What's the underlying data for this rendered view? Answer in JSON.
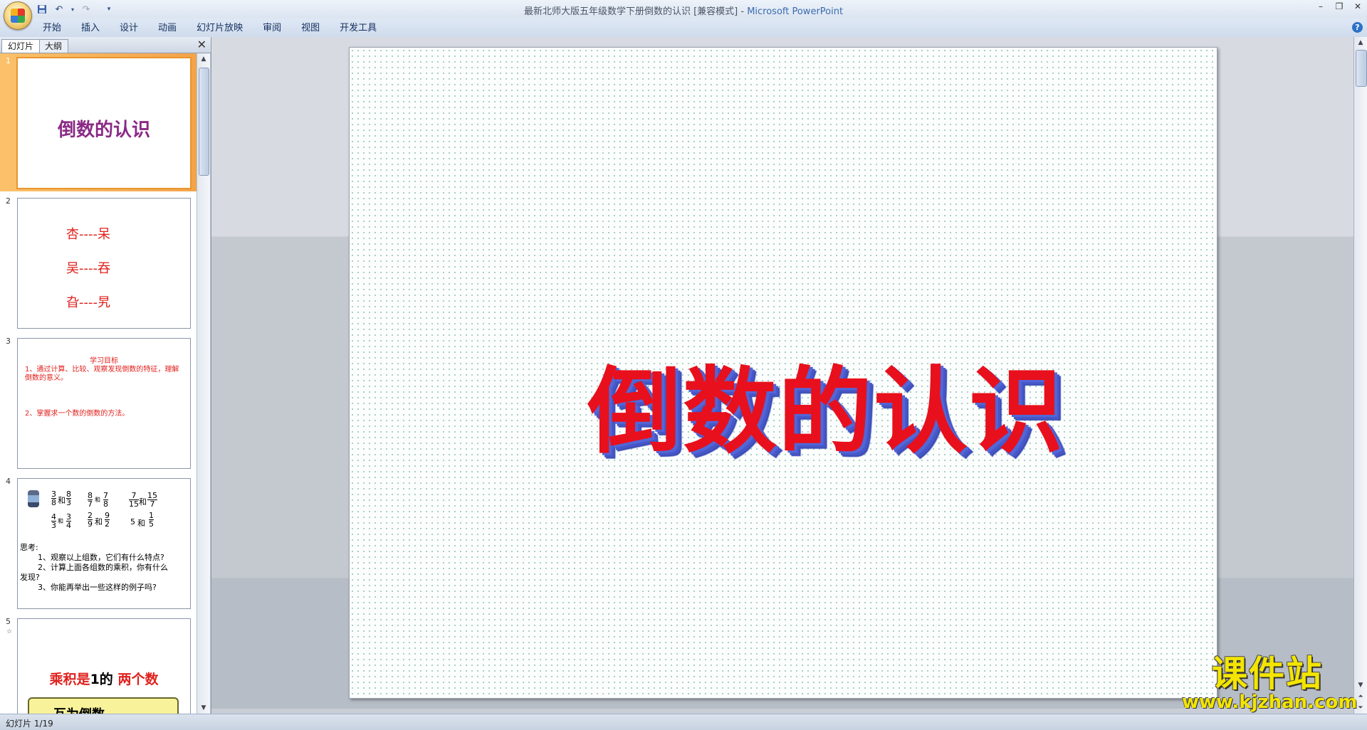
{
  "window": {
    "title": "最新北师大版五年级数学下册倒数的认识 [兼容模式]",
    "app_name": "Microsoft PowerPoint",
    "separator": " - "
  },
  "qat": {
    "save_icon": "save-icon",
    "undo_icon": "undo-icon",
    "redo_icon": "redo-icon",
    "customize_icon": "customize-icon"
  },
  "ribbon": {
    "tabs": [
      "开始",
      "插入",
      "设计",
      "动画",
      "幻灯片放映",
      "审阅",
      "视图",
      "开发工具"
    ]
  },
  "pane": {
    "tabs": [
      "幻灯片",
      "大纲"
    ],
    "close": "✕"
  },
  "thumbnails": {
    "s1": {
      "num": "1",
      "title": "倒数的认识"
    },
    "s2": {
      "num": "2",
      "lines": [
        "杏----呆",
        "吴----吞",
        "旮----旯"
      ]
    },
    "s3": {
      "num": "3",
      "heading": "学习目标",
      "line1": "1、通过计算、比较、观察发现倒数的特征，理解倒数的意义。",
      "line2": "2、掌握求一个数的倒数的方法。"
    },
    "s4": {
      "num": "4",
      "pairs": [
        {
          "a_n": "3",
          "a_d": "8",
          "b_n": "8",
          "b_d": "3"
        },
        {
          "a_n": "8",
          "a_d": "7",
          "b_n": "7",
          "b_d": "8"
        },
        {
          "a_n": "7",
          "a_d": "15",
          "b_n": "15",
          "b_d": "7"
        },
        {
          "a_n": "4",
          "a_d": "3",
          "b_n": "3",
          "b_d": "4"
        },
        {
          "a_n": "2",
          "a_d": "9",
          "b_n": "9",
          "b_d": "2"
        },
        {
          "whole": "5",
          "b_n": "1",
          "b_d": "5"
        }
      ],
      "and": "和",
      "think": "思考:",
      "q1": "1、观察以上组数，它们有什么特点?",
      "q2a": "2、计算上面各组数的乘积，你有什么",
      "q2b": "发现?",
      "q3": "3、你能再举出一些这样的例子吗?"
    },
    "s5": {
      "num": "5",
      "line_a": "乘积是",
      "line_b": "1",
      "line_c": "的",
      "line_d": "两个数",
      "scroll_text": "互为倒数"
    }
  },
  "slide": {
    "title": "倒数的认识"
  },
  "watermark": {
    "cn": "课件站",
    "url": "www.kjzhan.com"
  },
  "status": {
    "text": "幻灯片 1/19"
  },
  "colors": {
    "title_red": "#e8101c",
    "title_shadow": "#5266d8",
    "selected_thumb": "#f3a34a"
  }
}
